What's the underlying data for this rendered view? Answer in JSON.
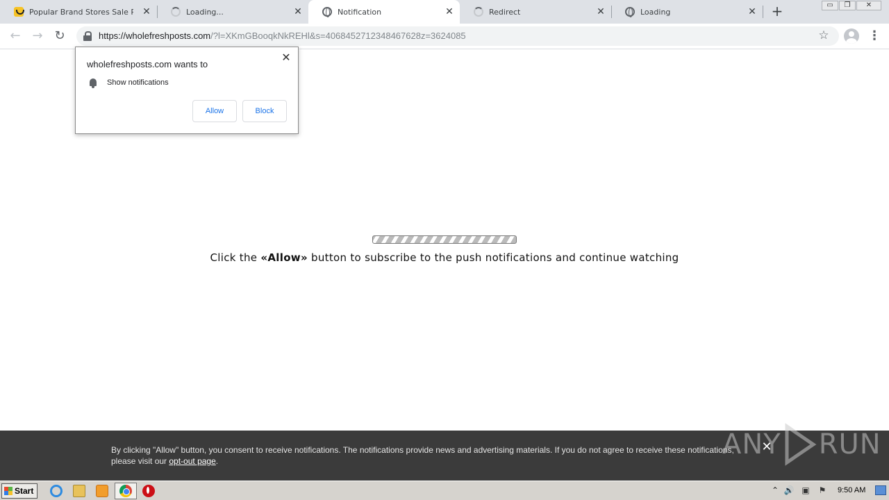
{
  "tabs": [
    {
      "title": "Popular Brand Stores Sale Promo",
      "icon": "brand-smiley-favicon",
      "active": false
    },
    {
      "title": "Loading...",
      "icon": "loading-spinner-icon",
      "active": false
    },
    {
      "title": "Notification",
      "icon": "globe-icon",
      "active": true
    },
    {
      "title": "Redirect",
      "icon": "loading-spinner-icon",
      "active": false
    },
    {
      "title": "Loading",
      "icon": "globe-icon",
      "active": false
    }
  ],
  "tab_close_glyph": "✕",
  "new_tab_glyph": "+",
  "window_controls": {
    "minimize": "▭",
    "restore": "❐",
    "close": "✕"
  },
  "toolbar": {
    "back_glyph": "←",
    "forward_glyph": "→",
    "reload_glyph": "↻",
    "star_glyph": "☆",
    "menu_glyph": "⋮"
  },
  "address": {
    "host": "https://wholefreshposts.com",
    "rest": "/?l=XKmGBooqkNkREHl&s=4068452712348467628z=3624085"
  },
  "permission_popup": {
    "title": "wholefreshposts.com wants to",
    "item": "Show notifications",
    "allow": "Allow",
    "block": "Block",
    "close_glyph": "✕"
  },
  "page": {
    "message_before": "Click the ",
    "message_bold": "«Allow»",
    "message_after": " button to subscribe to the push notifications and continue watching"
  },
  "consent": {
    "text": "By clicking \"Allow\" button, you consent to receive notifications. The notifications provide news and advertising materials. If you do not agree to receive these notifications, please visit our ",
    "link": "opt-out page",
    "end": ".",
    "close_glyph": "✕"
  },
  "watermark": {
    "left": "ANY",
    "right": "RUN"
  },
  "taskbar": {
    "start_label": "Start",
    "clock": "9:50 AM",
    "tray_arrow_glyph": "⌃",
    "tray_icons": [
      "speaker-icon",
      "network-icon",
      "flag-icon"
    ]
  },
  "colors": {
    "accent_blue": "#1a73e8",
    "tabstrip": "#dee1e6",
    "consent_bg": "#3b3b3b"
  }
}
